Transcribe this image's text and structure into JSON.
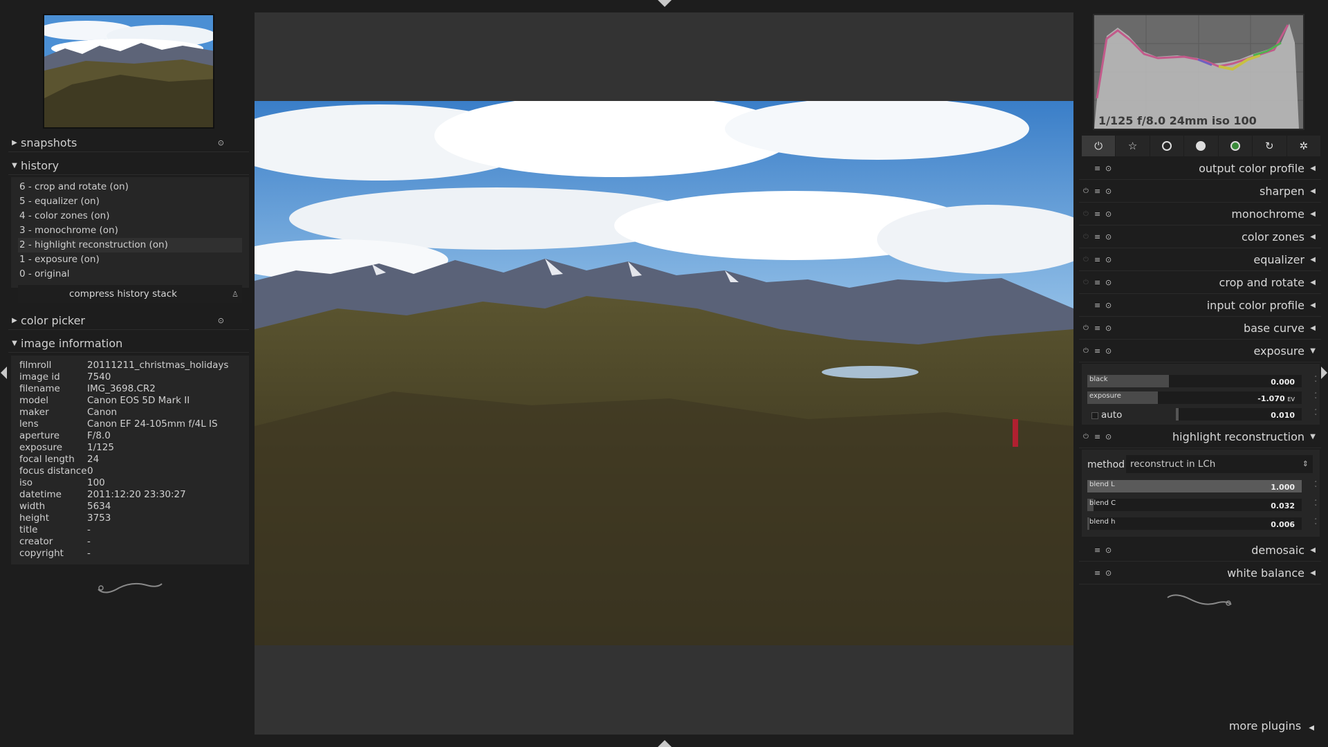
{
  "left": {
    "sections": {
      "snapshots": "snapshots",
      "history": "history",
      "color_picker": "color picker",
      "image_information": "image information"
    },
    "history_items": [
      "6 - crop and rotate (on)",
      "5 - equalizer (on)",
      "4 - color zones (on)",
      "3 - monochrome (on)",
      "2 - highlight reconstruction (on)",
      "1 - exposure (on)",
      "0 - original"
    ],
    "history_selected_index": 4,
    "compress_label": "compress history stack",
    "info": [
      {
        "key": "filmroll",
        "value": "20111211_christmas_holidays"
      },
      {
        "key": "image id",
        "value": "7540"
      },
      {
        "key": "filename",
        "value": "IMG_3698.CR2"
      },
      {
        "key": "model",
        "value": "Canon EOS 5D Mark II"
      },
      {
        "key": "maker",
        "value": "Canon"
      },
      {
        "key": "lens",
        "value": "Canon EF 24-105mm f/4L IS"
      },
      {
        "key": "aperture",
        "value": "F/8.0"
      },
      {
        "key": "exposure",
        "value": "1/125"
      },
      {
        "key": "focal length",
        "value": "24"
      },
      {
        "key": "focus distance",
        "value": "0"
      },
      {
        "key": "iso",
        "value": "100"
      },
      {
        "key": "datetime",
        "value": "2011:12:20 23:30:27"
      },
      {
        "key": "width",
        "value": "5634"
      },
      {
        "key": "height",
        "value": "3753"
      },
      {
        "key": "title",
        "value": "-"
      },
      {
        "key": "creator",
        "value": "-"
      },
      {
        "key": "copyright",
        "value": "-"
      }
    ]
  },
  "histogram_info": "1/125 f/8.0 24mm iso 100",
  "modules": {
    "output_color_profile": "output color profile",
    "sharpen": "sharpen",
    "monochrome": "monochrome",
    "color_zones": "color zones",
    "equalizer": "equalizer",
    "crop_and_rotate": "crop and rotate",
    "input_color_profile": "input color profile",
    "base_curve": "base curve",
    "exposure": "exposure",
    "highlight_reconstruction": "highlight reconstruction",
    "demosaic": "demosaic",
    "white_balance": "white balance"
  },
  "exposure_params": {
    "black_label": "black",
    "black_value": "0.000",
    "black_level": 0.38,
    "exposure_label": "exposure",
    "exposure_value": "-1.070",
    "exposure_unit": "EV",
    "exposure_level": 0.33,
    "auto_label": "auto",
    "auto_value": "0.010",
    "auto_level": 0.02
  },
  "highlight_params": {
    "method_label": "method",
    "method_value": "reconstruct in LCh",
    "blend_l_label": "blend L",
    "blend_l_value": "1.000",
    "blend_l_level": 1.0,
    "blend_c_label": "blend C",
    "blend_c_value": "0.032",
    "blend_c_level": 0.03,
    "blend_h_label": "blend h",
    "blend_h_value": "0.006",
    "blend_h_level": 0.01
  },
  "more_plugins": "more plugins"
}
